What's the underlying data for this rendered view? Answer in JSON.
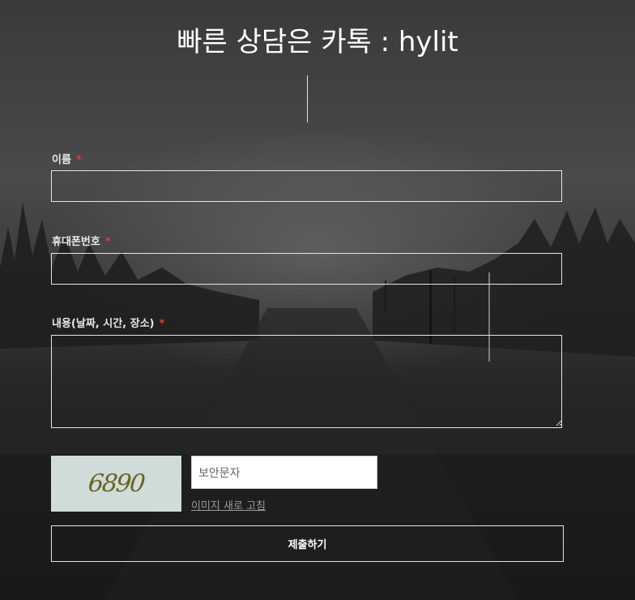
{
  "header": {
    "title": "빠른 상담은 카톡 : hylit"
  },
  "form": {
    "name_label": "이름",
    "phone_label": "휴대폰번호",
    "content_label": "내용(날짜, 시간, 장소)",
    "required_mark": "*",
    "captcha_code": "6890",
    "captcha_placeholder": "보안문자",
    "refresh_label": "이미지 새로 고침",
    "submit_label": "제출하기"
  },
  "colors": {
    "required": "#e53935",
    "border": "#e6e6e6"
  }
}
